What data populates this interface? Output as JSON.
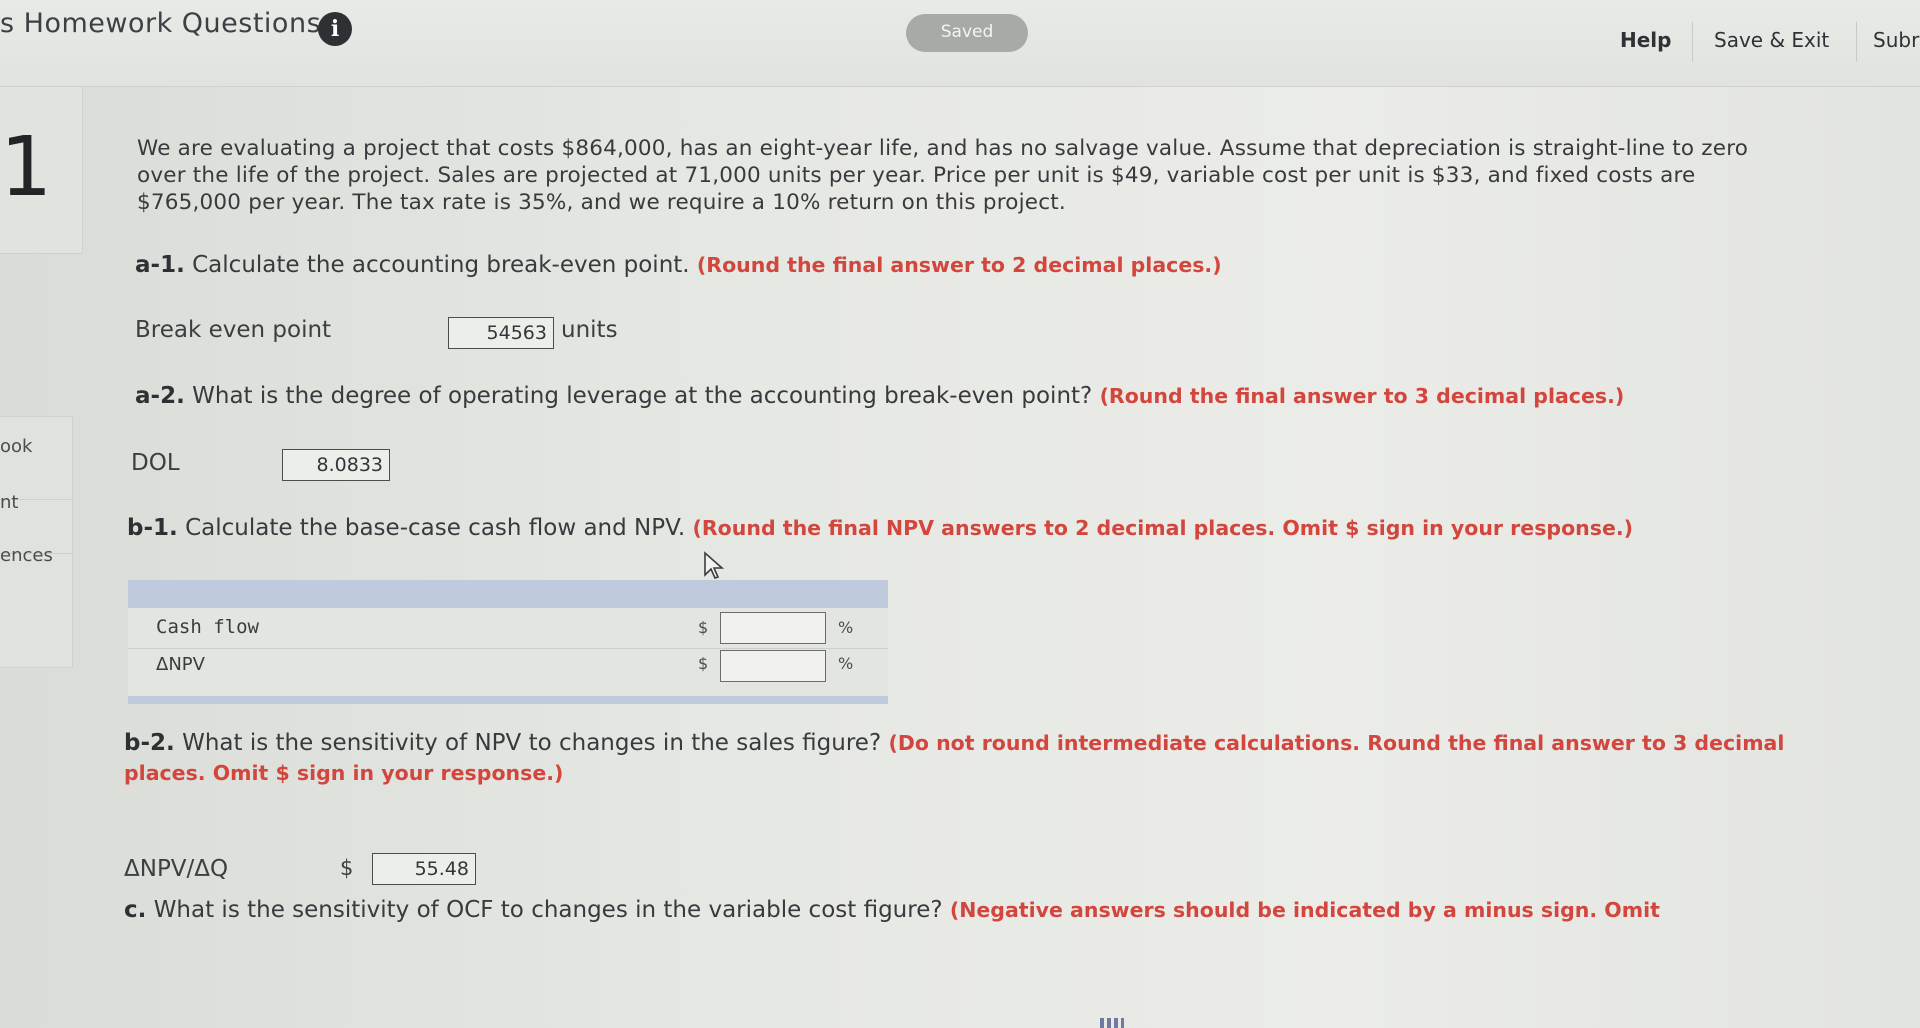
{
  "header": {
    "course_title": "s Homework Questions",
    "info_icon": "info-icon",
    "saved_label": "Saved",
    "help_label": "Help",
    "save_exit_label": "Save & Exit",
    "submit_label": "Subr"
  },
  "sidebar": {
    "question_number": "1",
    "items": [
      {
        "label": "ook"
      },
      {
        "label": "nt"
      },
      {
        "label": "ences"
      }
    ]
  },
  "question": {
    "intro": "We are evaluating a project that costs $864,000, has an eight-year life, and has no salvage value. Assume that depreciation is straight-line to zero over the life of the project. Sales are projected at 71,000 units per year. Price per unit is $49, variable cost per unit is $33, and fixed costs are $765,000 per year. The tax rate is 35%, and we require a 10% return on this project.",
    "a1": {
      "num": "a-1.",
      "text": "Calculate the accounting break-even point.",
      "instruction": "(Round the final answer to 2 decimal places.)",
      "field_label": "Break even point",
      "value": "54563",
      "unit": "units"
    },
    "a2": {
      "num": "a-2.",
      "text": "What is the degree of operating leverage at the accounting break-even point?",
      "instruction": "(Round the final answer to 3 decimal places.)",
      "field_label": "DOL",
      "value": "8.0833"
    },
    "b1": {
      "num": "b-1.",
      "text": "Calculate the base-case cash flow and NPV.",
      "instruction": "(Round the final NPV answers to 2 decimal places. Omit $ sign in your response.)",
      "rows": [
        {
          "label": "Cash flow",
          "currency": "$",
          "value": "",
          "suffix": "%"
        },
        {
          "label": "ΔNPV",
          "currency": "$",
          "value": "",
          "suffix": "%"
        }
      ]
    },
    "b2": {
      "num": "b-2.",
      "text": "What is the sensitivity of NPV to changes in the sales figure?",
      "instruction": "(Do not round intermediate calculations. Round the final answer to 3 decimal places. Omit $ sign in your response.)",
      "field_label": "ΔNPV/ΔQ",
      "currency": "$",
      "value": "55.48"
    },
    "c": {
      "num": "c.",
      "text": "What is the sensitivity of OCF to changes in the variable cost figure?",
      "instruction": "(Negative answers should be indicated by a minus sign. Omit"
    }
  }
}
